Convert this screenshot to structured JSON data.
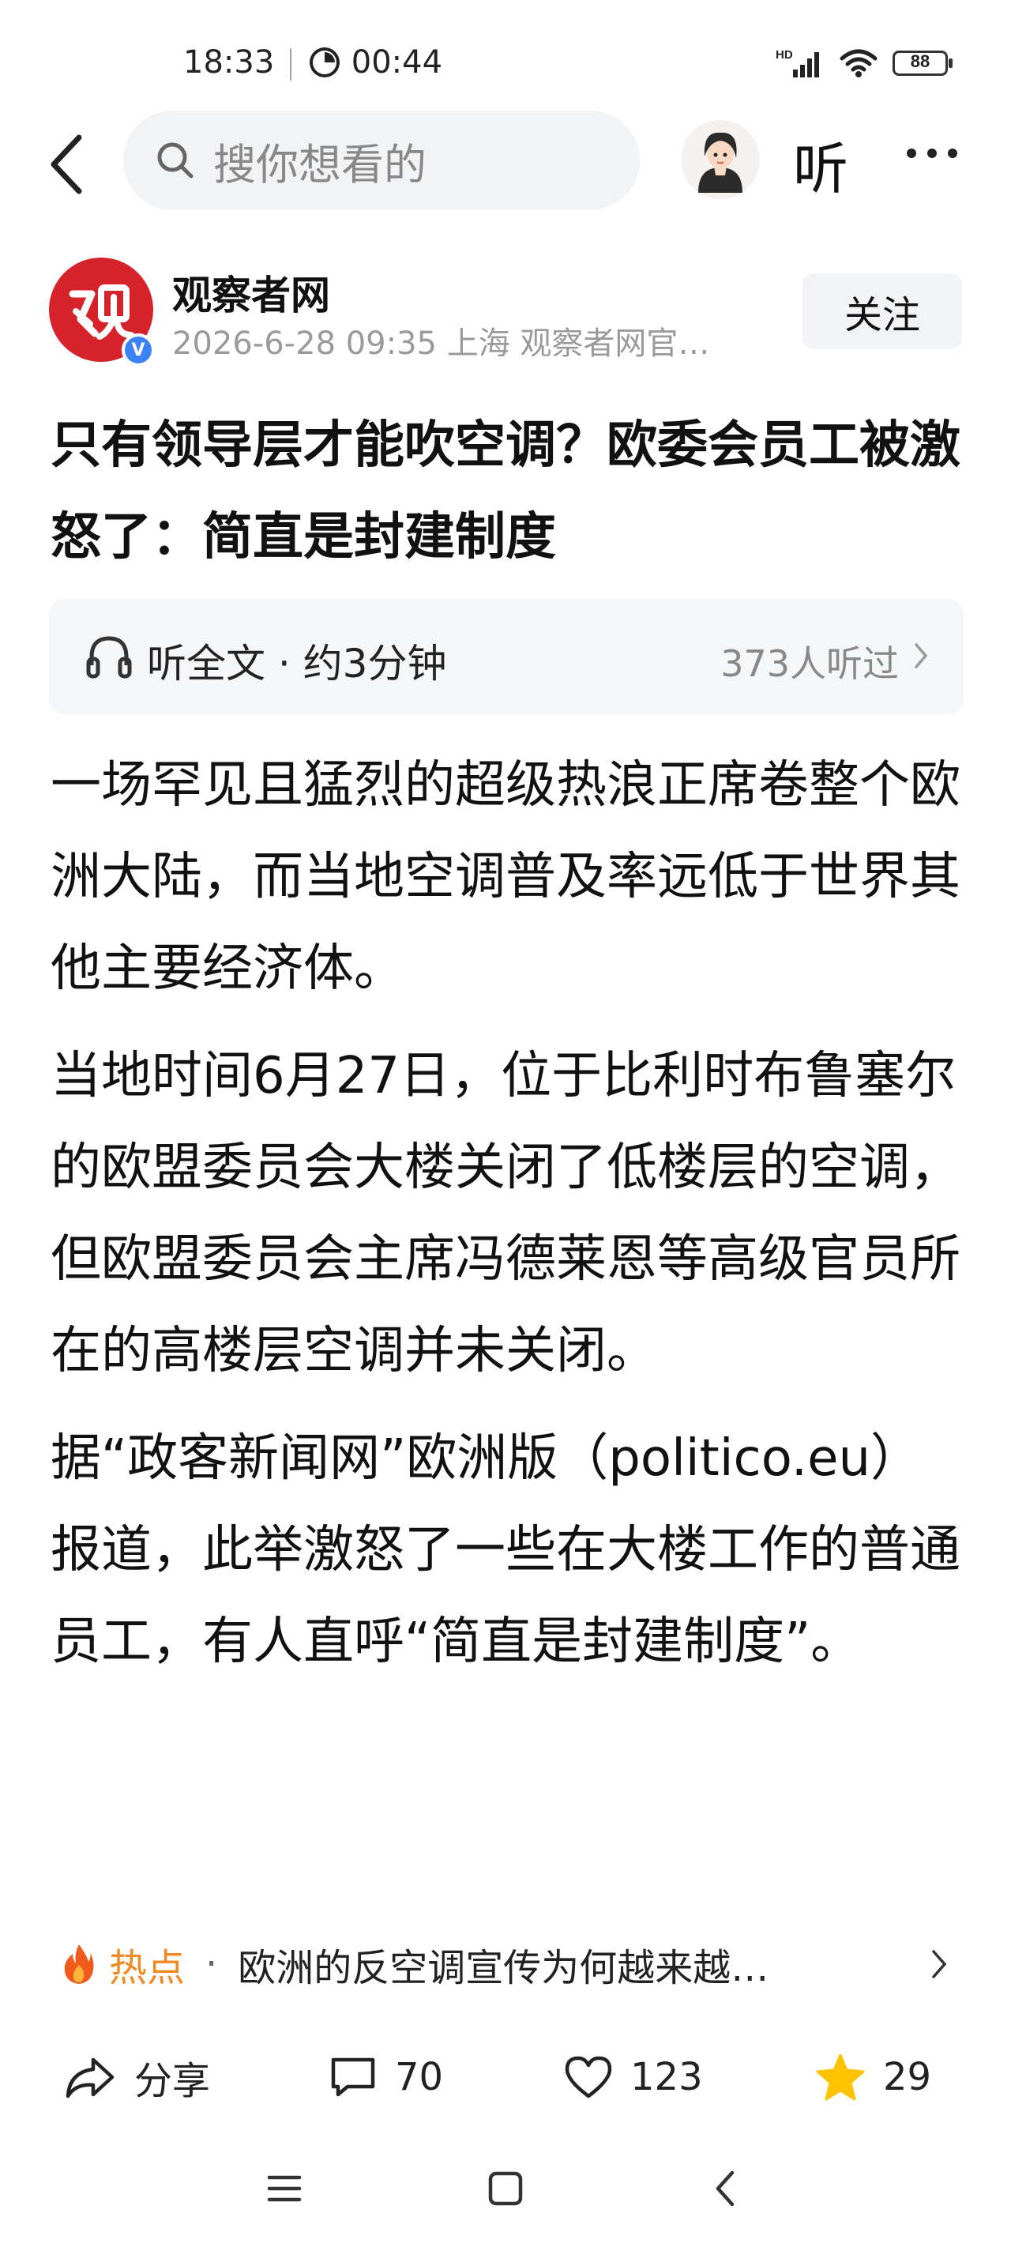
{
  "status_bar": {
    "time": "18:33",
    "separator": "|",
    "timer": "00:44",
    "network": "HD",
    "battery": "88"
  },
  "nav": {
    "search_placeholder": "搜你想看的",
    "listen_label": "听"
  },
  "author": {
    "name": "观察者网",
    "meta": "2026-6-28  09:35  上海  观察者网官…",
    "follow_label": "关注",
    "verified_badge": "V"
  },
  "title": "只有领导层才能吹空调？欧委会员工被激怒了：简直是封建制度",
  "listen_bar": {
    "label": "听全文 · 约3分钟",
    "count": "373人听过"
  },
  "article": {
    "paragraphs": [
      "一场罕见且猛烈的超级热浪正席卷整个欧洲大陆，而当地空调普及率远低于世界其他主要经济体。",
      "当地时间6月27日，位于比利时布鲁塞尔的欧盟委员会大楼关闭了低楼层的空调，但欧盟委员会主席冯德莱恩等高级官员所在的高楼层空调并未关闭。",
      "据“政客新闻网”欧洲版（politico.eu）报道，此举激怒了一些在大楼工作的普通员工，有人直呼“简直是封建制度”。"
    ]
  },
  "hot": {
    "label": "热点",
    "dot": "·",
    "text": "欧洲的反空调宣传为何越来越…"
  },
  "actions": {
    "share": "分享",
    "comments": "70",
    "likes": "123",
    "favorites": "29"
  },
  "colors": {
    "brand_red": "#d6232b",
    "hot_orange": "#f08a24",
    "star_yellow": "#ffc300",
    "verified_blue": "#3b82f6"
  }
}
